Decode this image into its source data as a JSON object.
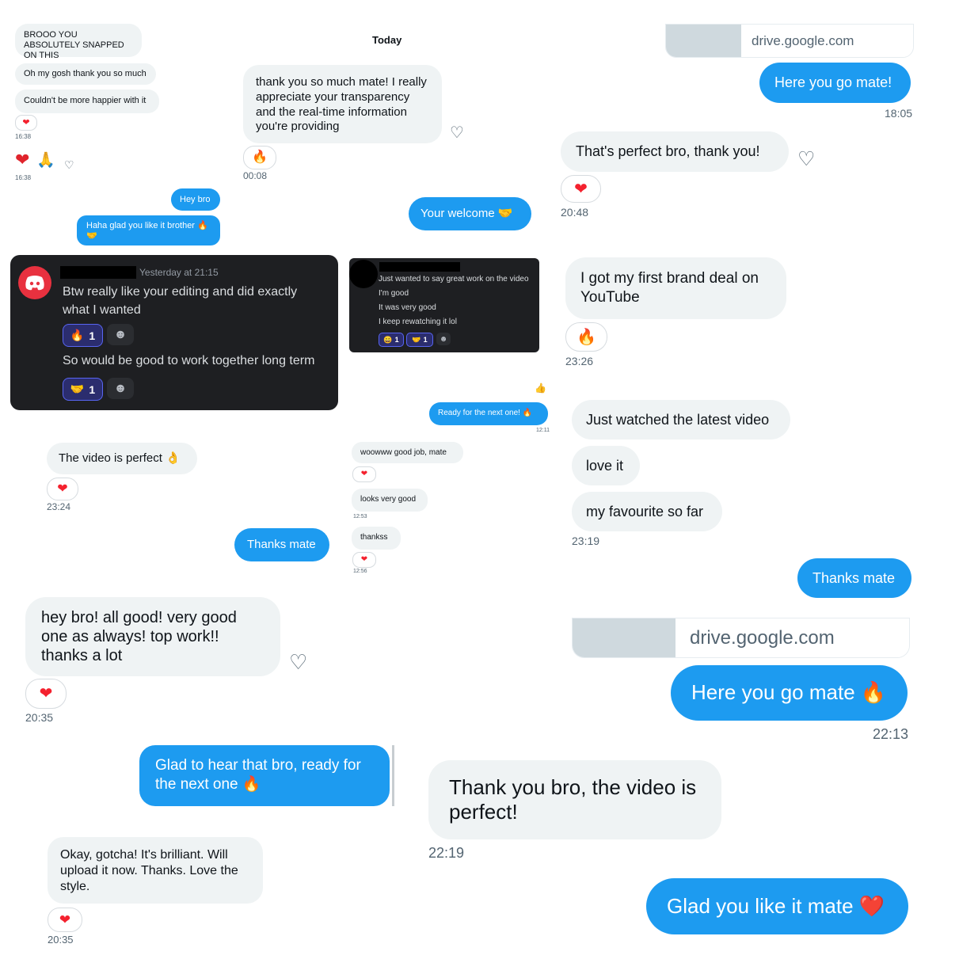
{
  "col1": {
    "msg1": "BROOO YOU ABSOLUTELY SNAPPED ON THIS",
    "msg2": "Oh my gosh thank you so much",
    "msg3": "Couldn't be more happier with it",
    "time1": "16:38",
    "time2": "16:38",
    "hey": "Hey bro",
    "glad": "Haha glad you like it brother 🔥 🤝"
  },
  "today": {
    "label": "Today",
    "thanks": "thank you so much mate! I really appreciate your transparency and the real-time information you're providing",
    "time": "00:08",
    "welcome": "Your welcome 🤝"
  },
  "discord1": {
    "timestamp": "Yesterday at 21:15",
    "msg1": "Btw really like your editing and did exactly what I wanted",
    "reaction1_count": "1",
    "msg2": "So would be good to work together long term",
    "reaction2_count": "1"
  },
  "discord2": {
    "line1": "Just wanted to say great work on the video",
    "line2": "I'm good",
    "line3": "It was very good",
    "line4": "I keep rewatching it lol",
    "r1": "1",
    "r2": "1"
  },
  "video_perfect": {
    "text": "The video is perfect 👌",
    "time": "23:24"
  },
  "thanks_mate1": "Thanks mate",
  "mid": {
    "ready": "Ready for the next one! 🔥",
    "ready_time": "12:11",
    "woow": "woowww good job, mate",
    "looks": "looks very good",
    "looks_time": "12:53",
    "thankss": "thankss",
    "thankss_time": "12:56"
  },
  "right": {
    "drive1": "drive.google.com",
    "here1": "Here you go mate!",
    "here1_time": "18:05",
    "perfect": "That's perfect bro, thank you!",
    "perfect_time": "20:48",
    "brand": "I got my first brand deal on YouTube",
    "brand_time": "23:26",
    "watched": "Just watched the latest video",
    "love": "love it",
    "fav": "my favourite so far",
    "fav_time": "23:19",
    "thanks": "Thanks mate",
    "drive2": "drive.google.com",
    "here2": "Here you go mate 🔥",
    "here2_time": "22:13"
  },
  "heybro": {
    "text": "hey bro! all good! very good one as always! top work!! thanks a lot",
    "time": "20:35"
  },
  "glad_next": "Glad to hear that bro, ready for the next one 🔥",
  "okay": {
    "text": "Okay, gotcha! It's brilliant. Will upload it now. Thanks. Love the style.",
    "time": "20:35"
  },
  "thank_bro": {
    "text": "Thank you bro, the video is perfect!",
    "time": "22:19"
  },
  "glad_like": "Glad you like it mate ❤️",
  "icons": {
    "heart": "heart-icon",
    "fire": "fire-icon",
    "pray": "pray-icon",
    "handshake": "handshake-icon",
    "thumbs": "thumbs-up-icon",
    "add_reaction": "heart-plus-icon",
    "discord": "discord-logo-icon"
  }
}
